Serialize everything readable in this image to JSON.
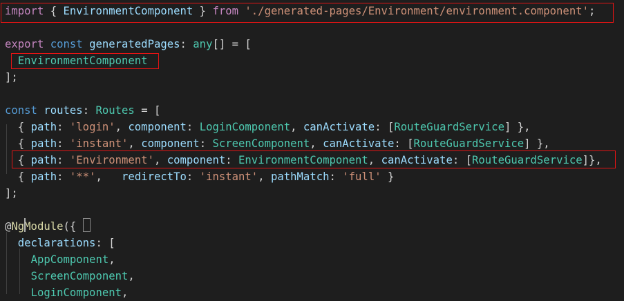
{
  "lines": [
    [
      {
        "t": "import",
        "c": "ctl"
      },
      {
        "t": " { ",
        "c": "pun"
      },
      {
        "t": "EnvironmentComponent",
        "c": "var"
      },
      {
        "t": " } ",
        "c": "pun"
      },
      {
        "t": "from",
        "c": "ctl"
      },
      {
        "t": " ",
        "c": "pun"
      },
      {
        "t": "'./generated-pages/Environment/environment.component'",
        "c": "str"
      },
      {
        "t": ";",
        "c": "pun"
      }
    ],
    [],
    [
      {
        "t": "export",
        "c": "ctl"
      },
      {
        "t": " ",
        "c": "pun"
      },
      {
        "t": "const",
        "c": "kw"
      },
      {
        "t": " ",
        "c": "pun"
      },
      {
        "t": "generatedPages",
        "c": "var"
      },
      {
        "t": ": ",
        "c": "pun"
      },
      {
        "t": "any",
        "c": "cls"
      },
      {
        "t": "[] = [",
        "c": "pun"
      }
    ],
    [
      {
        "t": "  ",
        "c": "pun"
      },
      {
        "t": "EnvironmentComponent",
        "c": "cls"
      }
    ],
    [
      {
        "t": "];",
        "c": "pun"
      }
    ],
    [],
    [
      {
        "t": "const",
        "c": "kw"
      },
      {
        "t": " ",
        "c": "pun"
      },
      {
        "t": "routes",
        "c": "var"
      },
      {
        "t": ": ",
        "c": "pun"
      },
      {
        "t": "Routes",
        "c": "cls"
      },
      {
        "t": " = [",
        "c": "pun"
      }
    ],
    [
      {
        "t": "  { ",
        "c": "pun"
      },
      {
        "t": "path",
        "c": "var"
      },
      {
        "t": ": ",
        "c": "pun"
      },
      {
        "t": "'login'",
        "c": "str"
      },
      {
        "t": ", ",
        "c": "pun"
      },
      {
        "t": "component",
        "c": "var"
      },
      {
        "t": ": ",
        "c": "pun"
      },
      {
        "t": "LoginComponent",
        "c": "cls"
      },
      {
        "t": ", ",
        "c": "pun"
      },
      {
        "t": "canActivate",
        "c": "var"
      },
      {
        "t": ": [",
        "c": "pun"
      },
      {
        "t": "RouteGuardService",
        "c": "cls"
      },
      {
        "t": "] },",
        "c": "pun"
      }
    ],
    [
      {
        "t": "  { ",
        "c": "pun"
      },
      {
        "t": "path",
        "c": "var"
      },
      {
        "t": ": ",
        "c": "pun"
      },
      {
        "t": "'instant'",
        "c": "str"
      },
      {
        "t": ", ",
        "c": "pun"
      },
      {
        "t": "component",
        "c": "var"
      },
      {
        "t": ": ",
        "c": "pun"
      },
      {
        "t": "ScreenComponent",
        "c": "cls"
      },
      {
        "t": ", ",
        "c": "pun"
      },
      {
        "t": "canActivate",
        "c": "var"
      },
      {
        "t": ": [",
        "c": "pun"
      },
      {
        "t": "RouteGuardService",
        "c": "cls"
      },
      {
        "t": "] },",
        "c": "pun"
      }
    ],
    [
      {
        "t": "  { ",
        "c": "pun"
      },
      {
        "t": "path",
        "c": "var"
      },
      {
        "t": ": ",
        "c": "pun"
      },
      {
        "t": "'Environment'",
        "c": "str"
      },
      {
        "t": ", ",
        "c": "pun"
      },
      {
        "t": "component",
        "c": "var"
      },
      {
        "t": ": ",
        "c": "pun"
      },
      {
        "t": "EnvironmentComponent",
        "c": "cls"
      },
      {
        "t": ", ",
        "c": "pun"
      },
      {
        "t": "canActivate",
        "c": "var"
      },
      {
        "t": ": [",
        "c": "pun"
      },
      {
        "t": "RouteGuardService",
        "c": "cls"
      },
      {
        "t": "]},",
        "c": "pun"
      }
    ],
    [
      {
        "t": "  { ",
        "c": "pun"
      },
      {
        "t": "path",
        "c": "var"
      },
      {
        "t": ": ",
        "c": "pun"
      },
      {
        "t": "'**'",
        "c": "str"
      },
      {
        "t": ",   ",
        "c": "pun"
      },
      {
        "t": "redirectTo",
        "c": "var"
      },
      {
        "t": ": ",
        "c": "pun"
      },
      {
        "t": "'instant'",
        "c": "str"
      },
      {
        "t": ", ",
        "c": "pun"
      },
      {
        "t": "pathMatch",
        "c": "var"
      },
      {
        "t": ": ",
        "c": "pun"
      },
      {
        "t": "'full'",
        "c": "str"
      },
      {
        "t": " }",
        "c": "pun"
      }
    ],
    [
      {
        "t": "];",
        "c": "pun"
      }
    ],
    [],
    [
      {
        "t": "@",
        "c": "pun"
      },
      {
        "t": "NgModule",
        "c": "fn"
      },
      {
        "t": "({",
        "c": "pun"
      }
    ],
    [
      {
        "t": "  ",
        "c": "pun"
      },
      {
        "t": "declarations",
        "c": "var"
      },
      {
        "t": ": [",
        "c": "pun"
      }
    ],
    [
      {
        "t": "    ",
        "c": "pun"
      },
      {
        "t": "AppComponent",
        "c": "cls"
      },
      {
        "t": ",",
        "c": "pun"
      }
    ],
    [
      {
        "t": "    ",
        "c": "pun"
      },
      {
        "t": "ScreenComponent",
        "c": "cls"
      },
      {
        "t": ",",
        "c": "pun"
      }
    ],
    [
      {
        "t": "    ",
        "c": "pun"
      },
      {
        "t": "LoginComponent",
        "c": "cls"
      },
      {
        "t": ",",
        "c": "pun"
      }
    ]
  ],
  "colors": {
    "background": "#1e1e1e",
    "highlight_box": "#e51414",
    "keyword": "#569cd6",
    "control": "#c586c0",
    "variable": "#9cdcfe",
    "class": "#4ec9b0",
    "string": "#ce9178",
    "function": "#dcdcaa"
  }
}
